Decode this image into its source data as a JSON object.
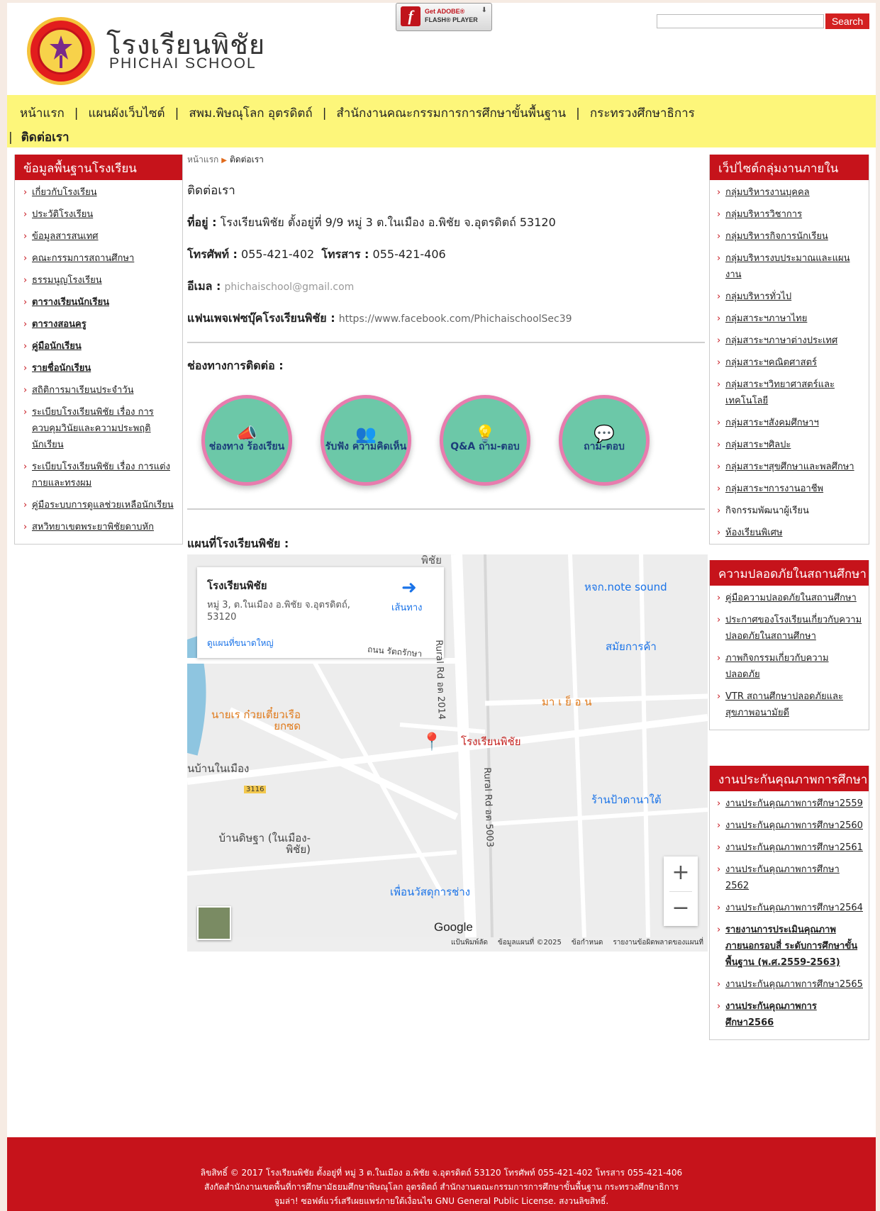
{
  "header": {
    "school_name_th": "โรงเรียนพิชัย",
    "school_name_en": "PHICHAI SCHOOL",
    "flash_line1": "Get ADOBE®",
    "flash_line2": "FLASH® PLAYER",
    "search_placeholder": "",
    "search_button": "Search"
  },
  "nav": {
    "items": [
      "หน้าแรก",
      "แผนผังเว็บไซต์",
      "สพม.พิษณุโลก อุตรดิตถ์",
      "สำนักงานคณะกรรมการการศึกษาขั้นพื้นฐาน",
      "กระทรวงศึกษาธิการ",
      "ติดต่อเรา"
    ],
    "separator": "|"
  },
  "left_sidebar": {
    "title": "ข้อมูลพื้นฐานโรงเรียน",
    "items": [
      "เกี่ยวกับโรงเรียน",
      "ประวัติโรงเรียน",
      "ข้อมูลสารสนเทศ",
      "คณะกรรมการสถานศึกษา",
      "ธรรมนูญโรงเรียน",
      "ตารางเรียนนักเรียน",
      "ตารางสอนครู",
      "คู่มือนักเรียน",
      "รายชื่อนักเรียน",
      "สถิติการมาเรียนประจำวัน",
      "ระเบียบโรงเรียนพิชัย เรื่อง การควบคุมวินัยและความประพฤตินักเรียน",
      "ระเบียบโรงเรียนพิชัย เรื่อง การแต่งกายและทรงผม",
      "คู่มือระบบการดูแลช่วยเหลือนักเรียน",
      "สหวิทยาเขตพระยาพิชัยดาบหัก"
    ]
  },
  "right_sidebar": {
    "box1_title": "เว็ปไซต์กลุ่มงานภายใน",
    "box1_items": [
      "กลุ่มบริหารงานบุคคล",
      "กลุ่มบริหารวิชาการ",
      "กลุ่มบริหารกิจการนักเรียน",
      "กลุ่มบริหารงบประมาณและแผนงาน",
      "กลุ่มบริหารทั่วไป",
      "กลุ่มสาระฯภาษาไทย",
      "กลุ่มสาระฯภาษาต่างประเทศ",
      "กลุ่มสาระฯคณิตศาสตร์",
      "กลุ่มสาระฯวิทยาศาสตร์และเทคโนโลยี",
      "กลุ่มสาระฯสังคมศึกษาฯ",
      "กลุ่มสาระฯศิลปะ",
      "กลุ่มสาระฯสุขศึกษาและพลศึกษา",
      "กลุ่มสาระฯการงานอาชีพ",
      "กิจกรรมพัฒนาผู้เรียน",
      "ห้องเรียนพิเศษ"
    ],
    "box2_title": "ความปลอดภัยในสถานศึกษา",
    "box2_items": [
      "คู่มือความปลอดภัยในสถานศึกษา",
      "ประกาศของโรงเรียนเกี่ยวกับความปลอดภัยในสถานศึกษา",
      "ภาพกิจกรรมเกี่ยวกับความปลอดภัย",
      "VTR สถานศึกษาปลอดภัยและสุขภาพอนามัยดี"
    ],
    "box3_title": "งานประกันคุณภาพการศึกษา",
    "box3_items": [
      "งานประกันคุณภาพการศึกษา2559",
      "งานประกันคุณภาพการศึกษา2560",
      "งานประกันคุณภาพการศึกษา2561",
      "งานประกันคุณภาพการศึกษา 2562",
      "งานประกันคุณภาพการศึกษา2564",
      "รายงานการประเมินคุณภาพภายนอกรอบสี่ ระดับการศึกษาขั้นพื้นฐาน (พ.ศ.2559-2563)",
      "งานประกันคุณภาพการศึกษา2565",
      "งานประกันคุณภาพการศึกษา2566"
    ]
  },
  "main": {
    "breadcrumb_home": "หน้าแรก",
    "breadcrumb_current": "ติดต่อเรา",
    "title": "ติดต่อเรา",
    "address_label": "ที่อยู่ :",
    "address_value": "โรงเรียนพิชัย  ตั้งอยู่ที่ 9/9 หมู่ 3 ต.ในเมือง อ.พิชัย จ.อุตรดิตถ์ 53120",
    "phone_label": "โทรศัพท์ :",
    "phone_value": "055-421-402",
    "fax_label": "โทรสาร :",
    "fax_value": "055-421-406",
    "email_label": "อีเมล :",
    "email_value": "phichaischool@gmail.com",
    "fb_label": "แฟนเพจเฟซบุ๊คโรงเรียนพิชัย :",
    "fb_value": "https://www.facebook.com/PhichaischoolSec39",
    "channels_title": "ช่องทางการติดต่อ :",
    "channels": [
      "ช่องทาง ร้องเรียน",
      "รับฟัง ความคิดเห็น",
      "Q&A ถาม-ตอบ",
      "ถาม-ตอบ"
    ],
    "map_title": "แผนที่โรงเรียนพิชัย :"
  },
  "map": {
    "place_name": "โรงเรียนพิชัย",
    "place_address": "หมู่ 3, ต.ในเมือง อ.พิชัย จ.อุตรดิตถ์, 53120",
    "directions": "เส้นทาง",
    "view_larger": "ดูแผนที่ขนาดใหญ่",
    "labels": {
      "note_sound": "หจก.note sound",
      "samai": "สมัยการค้า",
      "maya": "มา เ ย็ อ น",
      "noodle": "นายเร ก๋วยเตี๋ยวเรือยกซด",
      "marker": "โรงเรียนพิชัย",
      "ban_nai_mueang": "นบ้านในเมือง",
      "ran_pa": "ร้านป้าดานาใต้",
      "ban_dit": "บ้านดิษฐา (ในเมือง-พิชัย)",
      "puean": "เพื่อนวัสดุการช่าง",
      "road1": "Rural Rd อต 2014",
      "road2": "Rural Rd อต 5003",
      "road3": "ถนน รัตถรักษา",
      "route": "3116",
      "top_label": "พิชัย"
    },
    "zoom_in": "+",
    "zoom_out": "−",
    "google": "Google",
    "footer": [
      "แป้นพิมพ์ลัด",
      "ข้อมูลแผนที่ ©2025",
      "ข้อกำหนด",
      "รายงานข้อผิดพลาดของแผนที่"
    ]
  },
  "footer": {
    "line1": "ลิขสิทธิ์ © 2017  โรงเรียนพิชัย  ตั้งอยู่ที่ หมู่ 3 ต.ในเมือง อ.พิชัย จ.อุตรดิตถ์ 53120  โทรศัพท์ 055-421-402  โทรสาร 055-421-406",
    "line2": "สังกัดสำนักงานเขตพื้นที่การศึกษามัธยมศึกษาพิษณุโลก อุตรดิตถ์  สำนักงานคณะกรรมการการศึกษาขั้นพื้นฐาน  กระทรวงศึกษาธิการ",
    "line3": "จูมล่า! ซอฟต์แวร์เสรีเผยแพร่ภายใต้เงื่อนไข GNU General Public License. สงวนลิขสิทธิ์."
  },
  "colors": {
    "accent": "#c6131b",
    "nav_bg": "#fdf67a",
    "link": "#1a73e8"
  }
}
